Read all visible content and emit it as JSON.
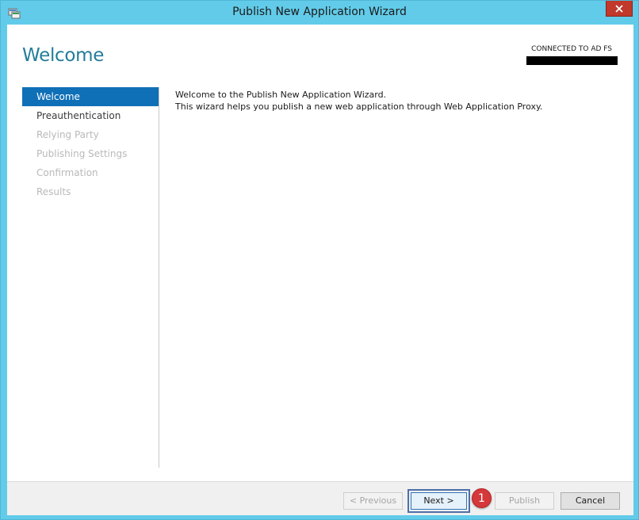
{
  "window": {
    "title": "Publish New Application Wizard",
    "icon": "wizard-app-icon",
    "close_icon": "close-icon"
  },
  "header": {
    "page_title": "Welcome",
    "server_label": "CONNECTED TO AD FS"
  },
  "nav": {
    "items": [
      {
        "label": "Welcome",
        "state": "active"
      },
      {
        "label": "Preauthentication",
        "state": "enabled"
      },
      {
        "label": "Relying Party",
        "state": "disabled"
      },
      {
        "label": "Publishing Settings",
        "state": "disabled"
      },
      {
        "label": "Confirmation",
        "state": "disabled"
      },
      {
        "label": "Results",
        "state": "disabled"
      }
    ]
  },
  "content": {
    "line1": "Welcome to the Publish New Application Wizard.",
    "line2": "This wizard helps you publish a new web application through Web Application Proxy."
  },
  "footer": {
    "previous_label": "< Previous",
    "next_label": "Next >",
    "publish_label": "Publish",
    "cancel_label": "Cancel",
    "step_badge": "1"
  },
  "colors": {
    "accent": "#0f70b7",
    "title_color": "#237d97",
    "frame": "#62cbe9",
    "badge": "#d4383a"
  }
}
